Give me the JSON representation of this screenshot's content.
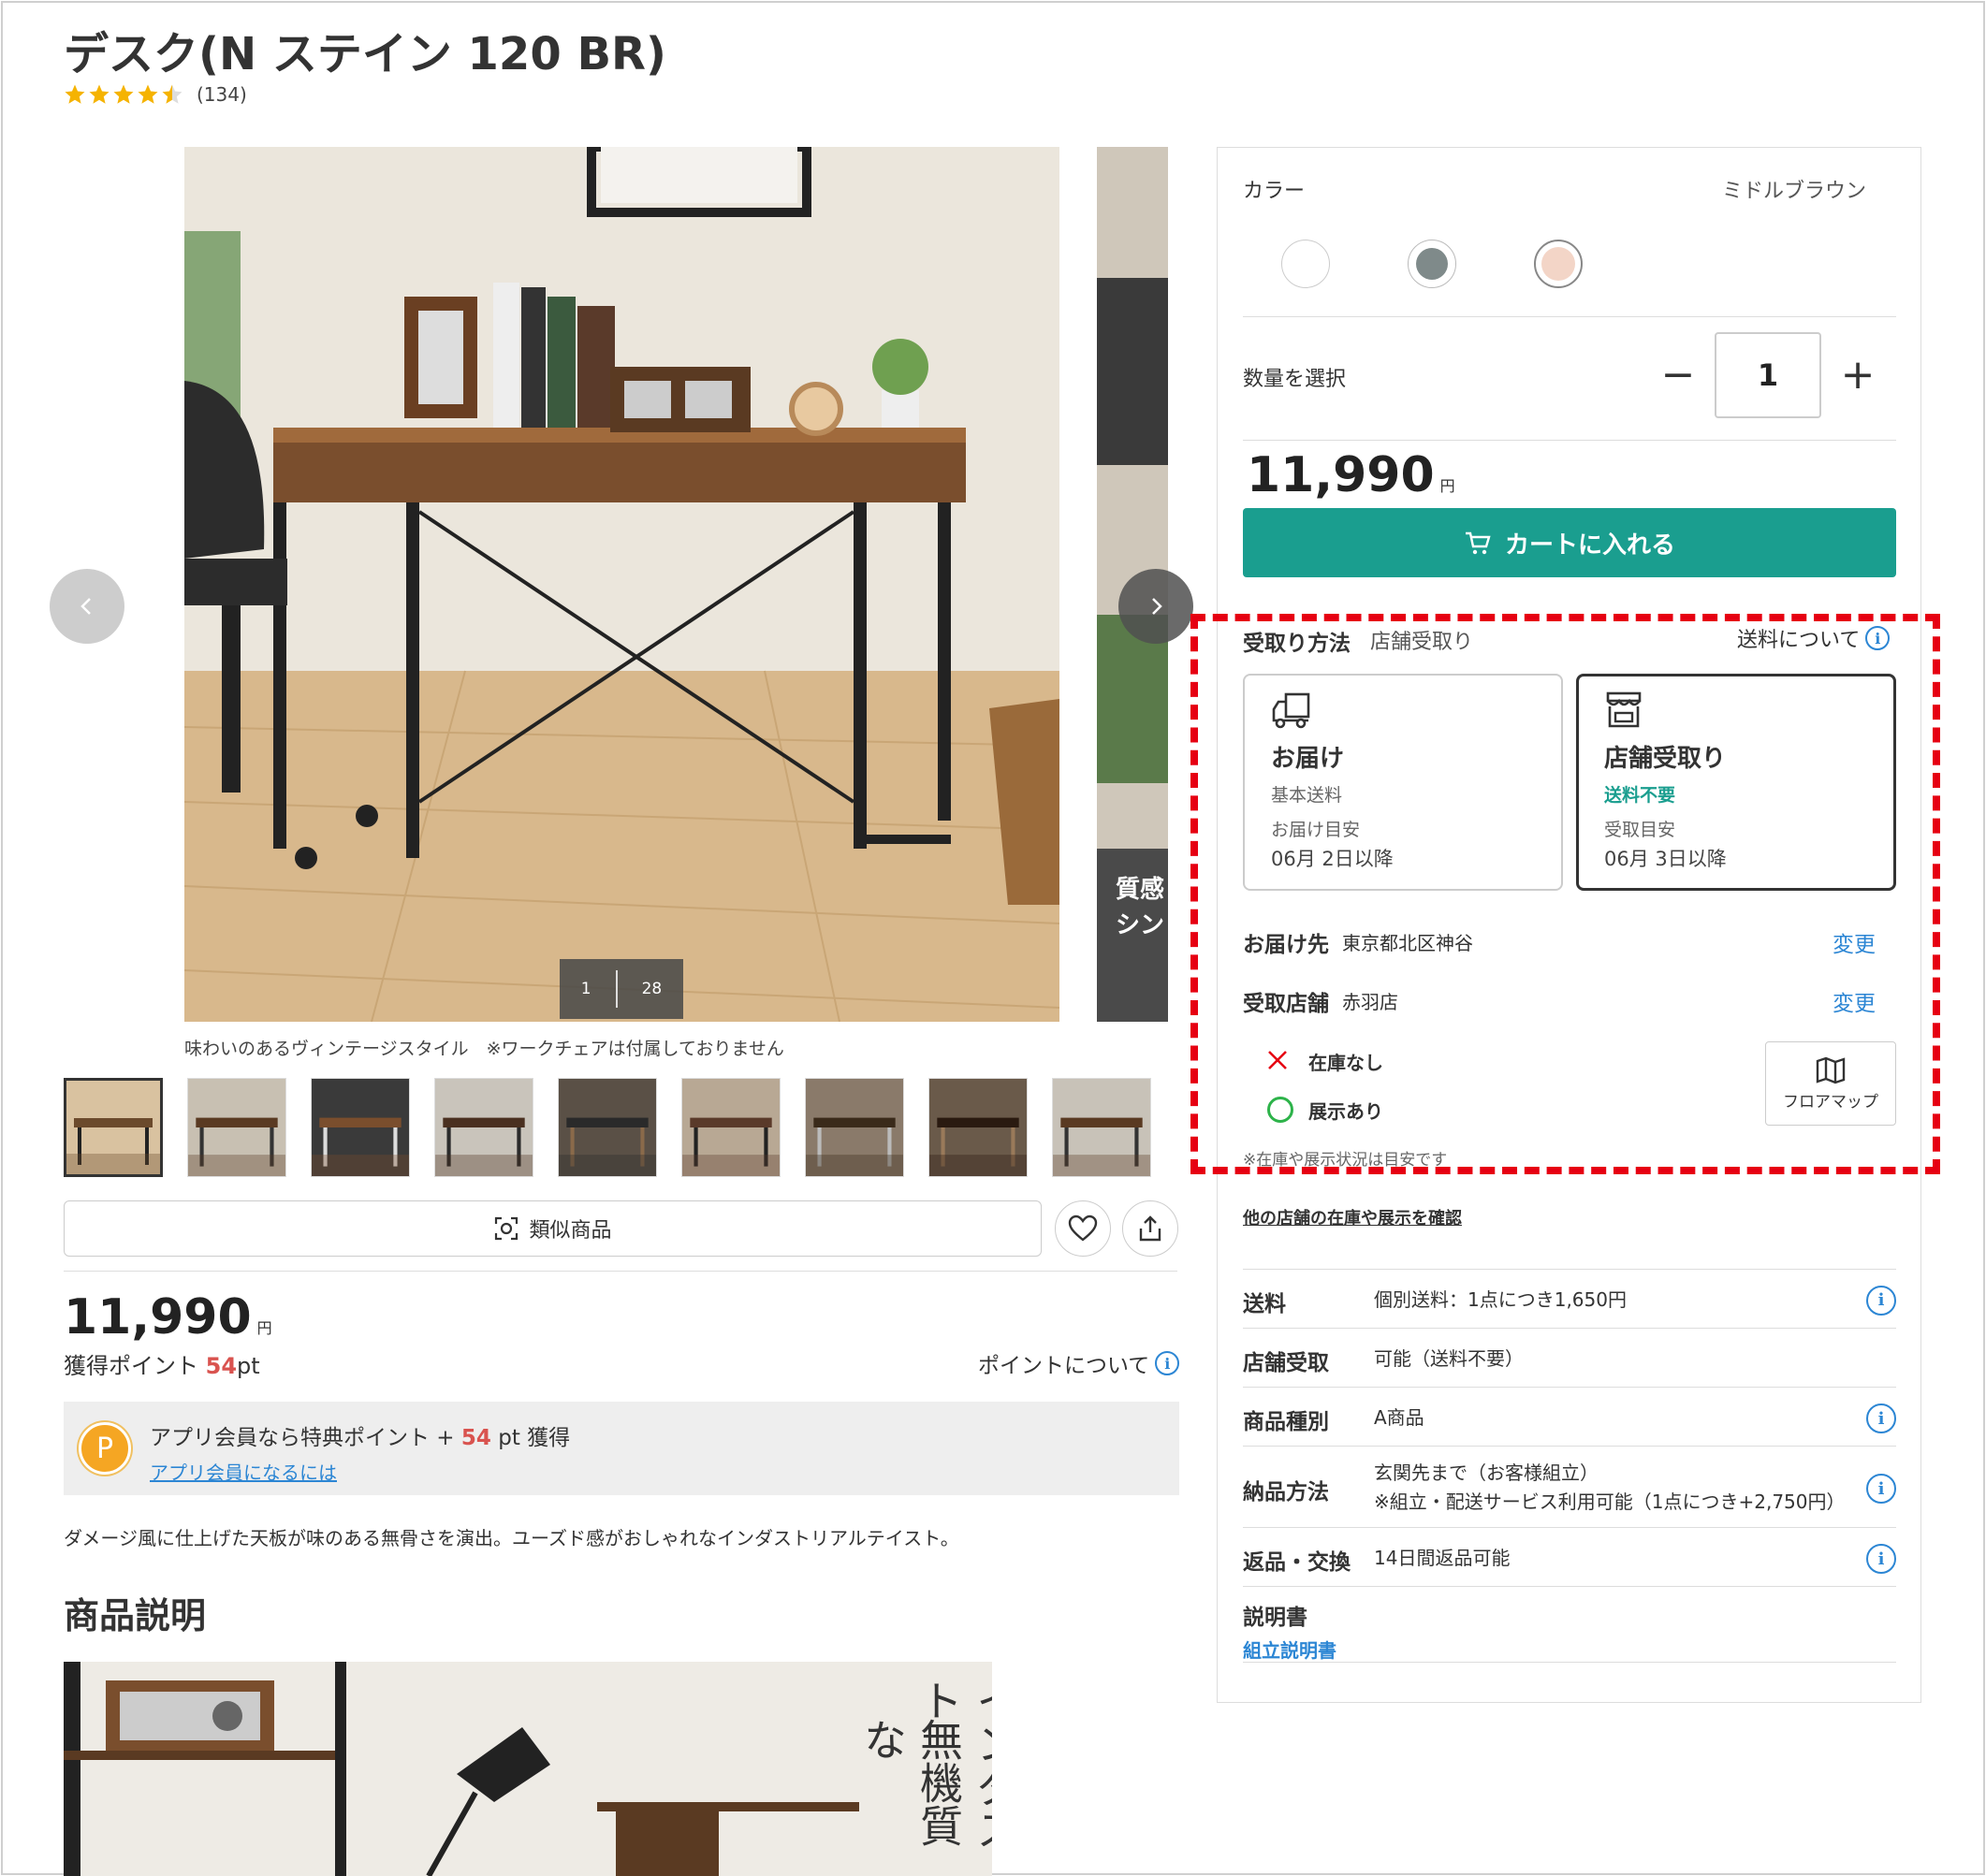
{
  "product": {
    "title": "デスク(N ステイン 120 BR)",
    "rating": 4.5,
    "review_count": "(134)",
    "caption": "味わいのあるヴィンテージスタイル　※ワークチェアは付属しておりません",
    "image_index": "1",
    "image_total": "28",
    "similar_label": "類似商品",
    "price": "11,990",
    "yen": "円",
    "points_label": "獲得ポイント",
    "points_value": "54",
    "points_unit": "pt",
    "point_about": "ポイントについて",
    "app_text_pre": "アプリ会員なら特典ポイント +",
    "app_points": "54",
    "app_text_post": "pt 獲得",
    "app_link": "アプリ会員になるには",
    "app_badge": "P",
    "description": "ダメージ風に仕上げた天板が味のある無骨さを演出。ユーズド感がおしゃれなインダストリアルテイスト。",
    "section_title": "商品説明"
  },
  "overlay_text": {
    "side_line1": "質感",
    "side_line2": "シン",
    "bottom_vertical1": "インダスト",
    "bottom_vertical2": "無機質な"
  },
  "purchase": {
    "color_label": "カラー",
    "color_value": "ミドルブラウン",
    "swatches": [
      "#ffffff",
      "#7f8a8a",
      "#f3d5c7"
    ],
    "qty_label": "数量を選択",
    "qty_minus": "−",
    "qty_value": "1",
    "qty_plus": "+",
    "price": "11,990",
    "yen": "円",
    "cart_label": "カートに入れる"
  },
  "pickup": {
    "label": "受取り方法",
    "value": "店舗受取り",
    "shipping_about": "送料について",
    "delivery": {
      "title": "お届け",
      "sub": "基本送料",
      "date_label": "お届け目安",
      "date": "06月 2日以降"
    },
    "store": {
      "title": "店舗受取り",
      "sub": "送料不要",
      "date_label": "受取目安",
      "date": "06月 3日以降"
    },
    "dest_label": "お届け先",
    "dest_value": "東京都北区神谷",
    "store_label": "受取店舗",
    "store_value": "赤羽店",
    "change": "変更",
    "stock": "在庫なし",
    "display": "展示あり",
    "floor_map": "フロアマップ",
    "note": "※在庫や展示状況は目安です",
    "other_store": "他の店舗の在庫や展示を確認"
  },
  "specs": [
    {
      "key": "送料",
      "value": "個別送料：1点につき1,650円",
      "info": true
    },
    {
      "key": "店舗受取",
      "value": "可能（送料不要）",
      "info": false
    },
    {
      "key": "商品種別",
      "value": "A商品",
      "info": true
    },
    {
      "key": "納品方法",
      "value": "玄関先まで（お客様組立）",
      "value2": "※組立・配送サービス利用可能（1点につき+2,750円）",
      "info": true
    },
    {
      "key": "返品・交換",
      "value": "14日間返品可能",
      "info": true
    }
  ],
  "manual": {
    "label": "説明書",
    "link": "組立説明書"
  },
  "colors": {
    "accent": "#1a9e8f",
    "link": "#2c86d4",
    "highlight": "#e60012",
    "points": "#d9534f"
  },
  "icons": {
    "star": "star-icon",
    "cart": "cart-icon",
    "info": "info-icon",
    "heart": "heart-icon",
    "share": "share-icon",
    "truck": "truck-icon",
    "store": "store-icon",
    "map": "map-icon",
    "camera": "camera-search-icon"
  }
}
